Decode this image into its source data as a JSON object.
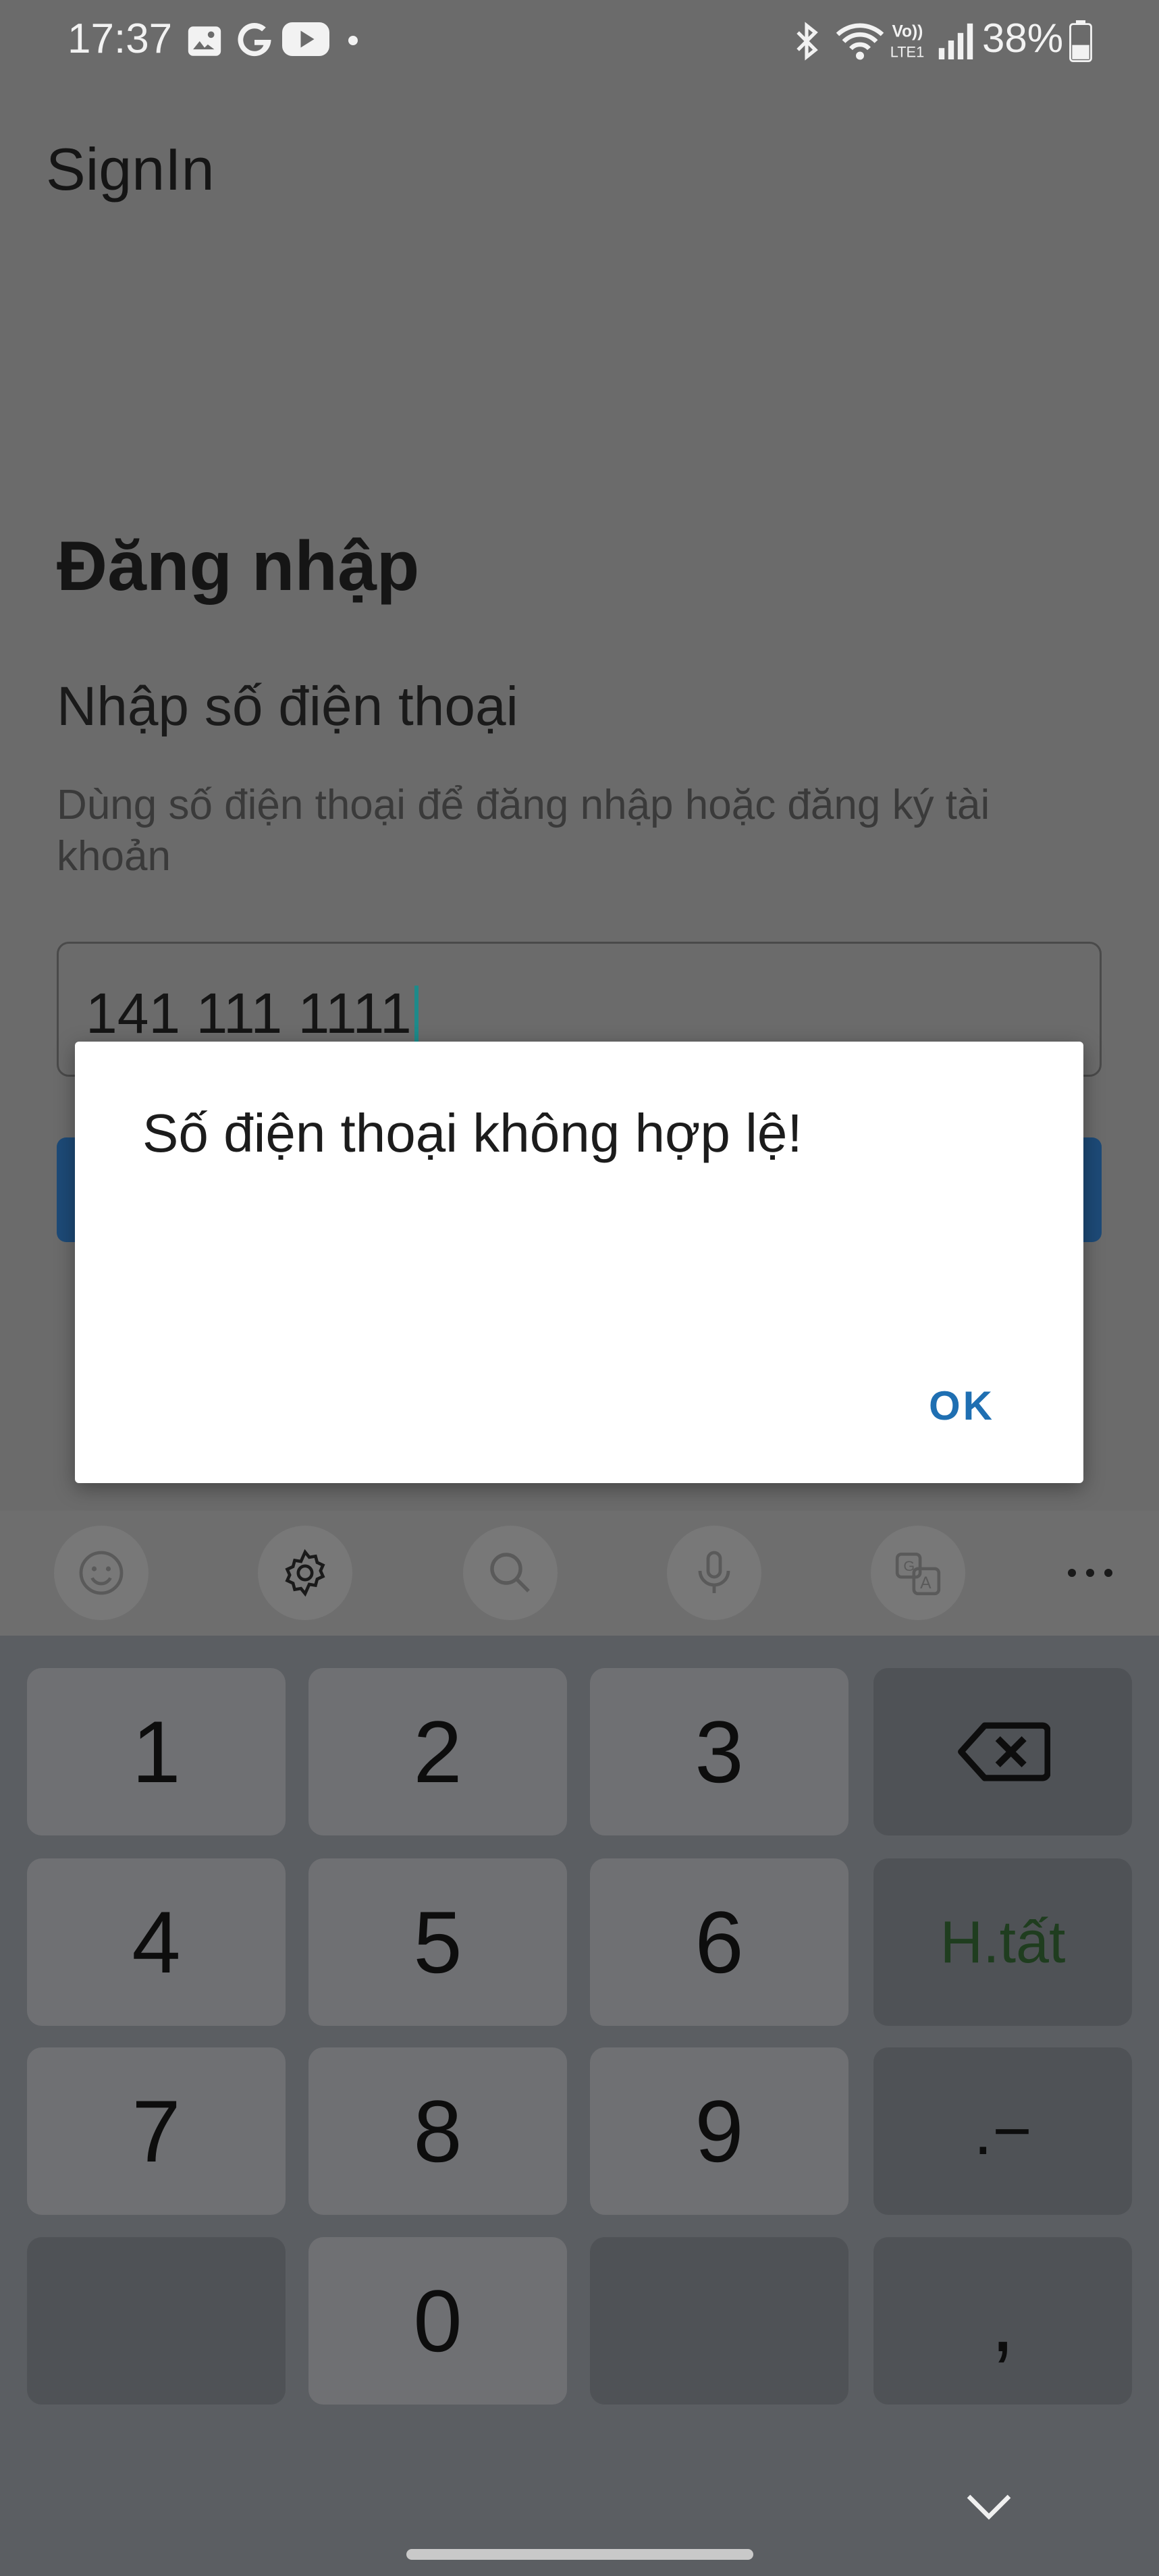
{
  "status_bar": {
    "time": "17:37",
    "battery": "38%",
    "icons": [
      "gallery-icon",
      "google-icon",
      "youtube-icon",
      "dot-icon",
      "bluetooth-icon",
      "wifi-icon",
      "volte-icon",
      "signal-icon",
      "battery-icon"
    ]
  },
  "app_bar": {
    "title": "SignIn"
  },
  "content": {
    "heading": "Đăng nhập",
    "subheading": "Nhập số điện thoại",
    "helper": "Dùng số điện thoại để đăng nhập hoặc đăng ký tài khoản",
    "phone_value": "141 111 1111"
  },
  "dialog": {
    "message": "Số điện thoại không hợp lệ!",
    "ok_label": "OK"
  },
  "keyboard": {
    "toolbar": [
      "emoji-icon",
      "settings-icon",
      "search-icon",
      "mic-icon",
      "translate-icon",
      "more-icon"
    ],
    "keys": [
      {
        "label": "1"
      },
      {
        "label": "2"
      },
      {
        "label": "3"
      },
      {
        "label": ""
      },
      {
        "label": "4"
      },
      {
        "label": "5"
      },
      {
        "label": "6"
      },
      {
        "label": "H.tất"
      },
      {
        "label": "7"
      },
      {
        "label": "8"
      },
      {
        "label": "9"
      },
      {
        "label": ".−"
      },
      {
        "label": ""
      },
      {
        "label": "0"
      },
      {
        "label": ""
      },
      {
        "label": ","
      }
    ]
  },
  "colors": {
    "accent": "#1f6fb2",
    "scrim": "#6b6b6b",
    "primary_button": "#1d4a77"
  }
}
